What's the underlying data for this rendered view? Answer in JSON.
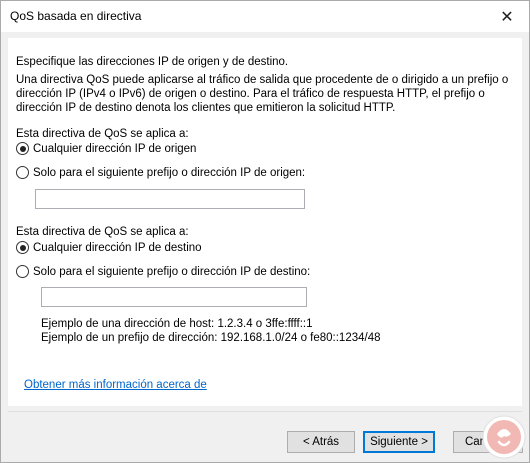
{
  "window": {
    "title": "QoS basada en directiva",
    "close_icon": "close-icon"
  },
  "intro": {
    "heading": "Especifique las direcciones IP de origen y de destino.",
    "line1": "Una directiva QoS puede aplicarse al tráfico de salida que procedente de o dirigido a un prefijo o",
    "line2": "dirección IP (IPv4 o IPv6) de origen o destino. Para el tráfico de respuesta HTTP, el prefijo o",
    "line3": "dirección IP de destino denota los clientes que emitieron la solicitud HTTP."
  },
  "source": {
    "label": "Esta directiva de QoS se aplica a:",
    "option_any": "Cualquier dirección IP de origen",
    "option_specific": "Solo para el siguiente prefijo o dirección IP de origen:",
    "selected": "any",
    "input_value": ""
  },
  "destination": {
    "label": "Esta directiva de QoS se aplica a:",
    "option_any": "Cualquier dirección IP de destino",
    "option_specific": "Solo para el siguiente prefijo o dirección IP de destino:",
    "selected": "any",
    "input_value": "",
    "example_host": "Ejemplo de una dirección de host: 1.2.3.4 o 3ffe:ffff::1",
    "example_prefix": "Ejemplo de un prefijo de dirección: 192.168.1.0/24 o fe80::1234/48"
  },
  "more_info_link": "Obtener más información acerca de",
  "buttons": {
    "back": "< Atrás",
    "next": "Siguiente >",
    "cancel": "Cancelar"
  },
  "watermark_icon": "solvetic-logo"
}
